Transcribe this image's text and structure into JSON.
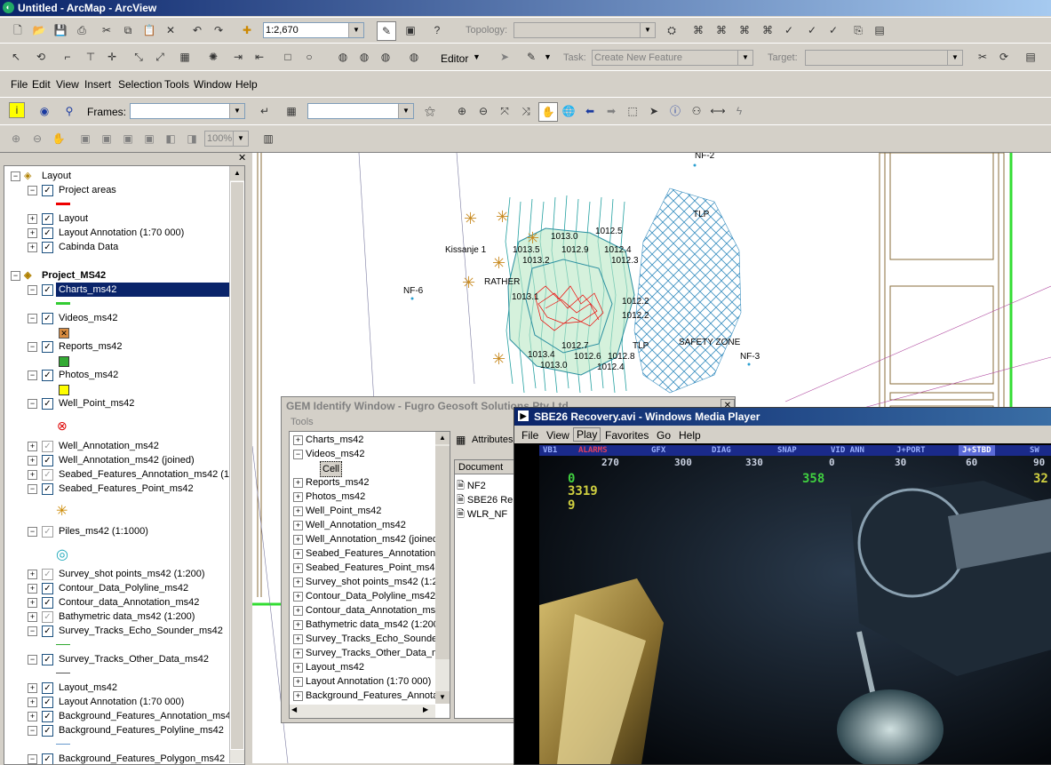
{
  "window": {
    "title": "Untitled - ArcMap - ArcView"
  },
  "toolbar1": {
    "scale": "1:2,670",
    "topology_label": "Topology:"
  },
  "toolbar2": {
    "editor_label": "Editor",
    "task_label": "Task:",
    "task_value": "Create New Feature",
    "target_label": "Target:"
  },
  "menu": [
    "File",
    "Edit",
    "View",
    "Insert",
    "Selection",
    "Tools",
    "Window",
    "Help"
  ],
  "toolbar3": {
    "frames_label": "Frames:"
  },
  "toolbar4": {
    "zoom": "100%"
  },
  "toc": {
    "groups": [
      {
        "name": "Layout",
        "y": 0
      },
      {
        "name": "Project_MS42",
        "y": 0
      }
    ],
    "items": [
      "Layout",
      "Project areas",
      "Layout",
      "Layout Annotation (1:70 000)",
      "Cabinda Data",
      "Project_MS42",
      "Charts_ms42",
      "Videos_ms42",
      "Reports_ms42",
      "Photos_ms42",
      "Well_Point_ms42",
      "Well_Annotation_ms42",
      "Well_Annotation_ms42 (joined)",
      "Seabed_Features_Annotation_ms42 (1:",
      "Seabed_Features_Point_ms42",
      "Piles_ms42 (1:1000)",
      "Survey_shot points_ms42 (1:200)",
      "Contour_Data_Polyline_ms42",
      "Contour_data_Annotation_ms42",
      "Bathymetric data_ms42 (1:200)",
      "Survey_Tracks_Echo_Sounder_ms42",
      "Survey_Tracks_Other_Data_ms42",
      "Layout_ms42",
      "Layout Annotation (1:70 000)",
      "Background_Features_Annotation_ms42",
      "Background_Features_Polyline_ms42",
      "Background_Features_Polygon_ms42"
    ]
  },
  "map": {
    "labels": [
      "NF-2",
      "TLP",
      "Kissanje 1",
      "1013.0",
      "1012.5",
      "1013.5",
      "1012.9",
      "1012.4",
      "1013.2",
      "1012.3",
      "RATHER",
      "NF-6",
      "1013.1",
      "1012.2",
      "1012.2",
      "TLP",
      "SAFETY ZONE",
      "1012.7",
      "NF-3",
      "1013.4",
      "1012.6",
      "1012.8",
      "1013.0",
      "1012.4"
    ]
  },
  "gem": {
    "title": "GEM Identify Window - Fugro Geosoft Solutions Pty Ltd",
    "menu": "Tools",
    "tree": [
      "Charts_ms42",
      "Videos_ms42",
      "Cell",
      "Reports_ms42",
      "Photos_ms42",
      "Well_Point_ms42",
      "Well_Annotation_ms42",
      "Well_Annotation_ms42 (joined)",
      "Seabed_Features_Annotation_",
      "Seabed_Features_Point_ms42",
      "Survey_shot points_ms42 (1:20",
      "Contour_Data_Polyline_ms42",
      "Contour_data_Annotation_ms4",
      "Bathymetric data_ms42 (1:200)",
      "Survey_Tracks_Echo_Sounde",
      "Survey_Tracks_Other_Data_m",
      "Layout_ms42",
      "Layout Annotation (1:70 000)",
      "Background_Features_Annota"
    ],
    "attributes_label": "Attributes",
    "column": "Document",
    "docs": [
      "NF2",
      "SBE26 Re",
      "WLR_NF"
    ]
  },
  "wmp": {
    "title": "SBE26 Recovery.avi - Windows Media Player",
    "menu": [
      "File",
      "View",
      "Play",
      "Favorites",
      "Go",
      "Help"
    ],
    "osd_tabs": [
      "VB1",
      "ALARMS",
      "GFX",
      "DIAG",
      "SNAP",
      "VID ANN",
      "J+PORT",
      "J+STBD",
      "SW"
    ],
    "compass": [
      "270",
      "300",
      "330",
      "0",
      "30",
      "60",
      "90"
    ],
    "readouts": [
      "0",
      "3319",
      "9",
      "358",
      "32"
    ]
  }
}
